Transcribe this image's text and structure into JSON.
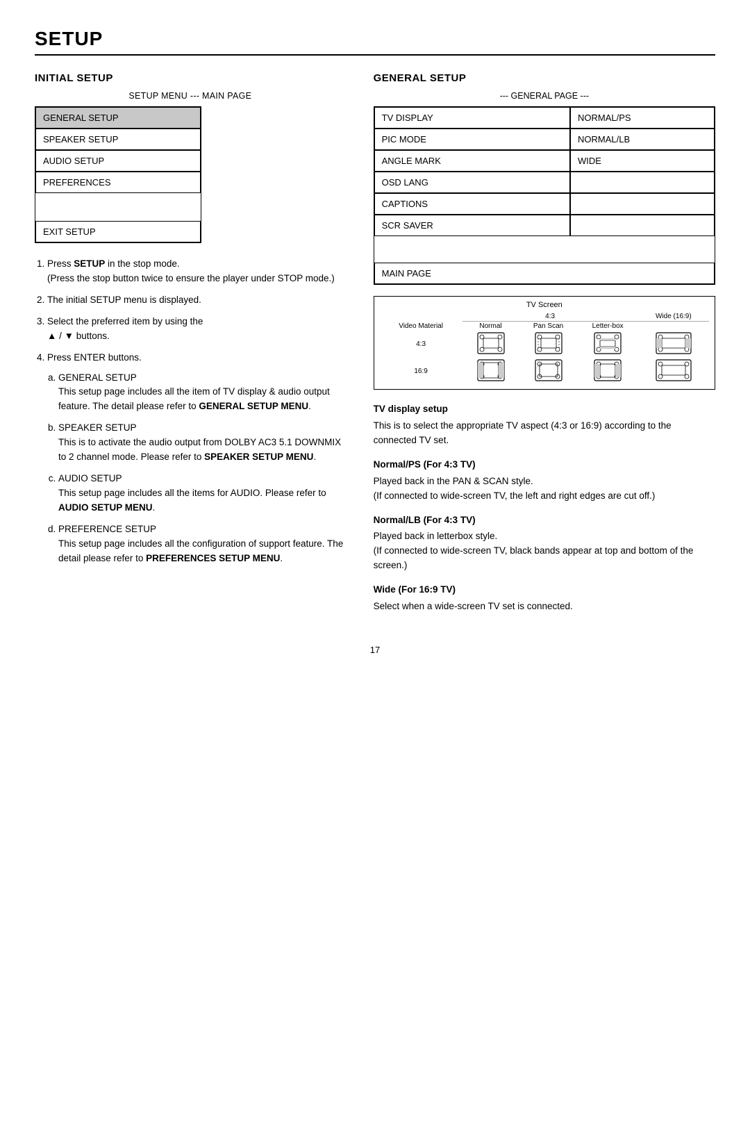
{
  "title": "SETUP",
  "left": {
    "section_title": "INITIAL SETUP",
    "menu_label": "SETUP MENU --- MAIN PAGE",
    "menu_items": [
      {
        "label": "GENERAL SETUP",
        "highlighted": true
      },
      {
        "label": "SPEAKER SETUP",
        "highlighted": false
      },
      {
        "label": "AUDIO SETUP",
        "highlighted": false
      },
      {
        "label": "PREFERENCES",
        "highlighted": false
      }
    ],
    "exit_item": "EXIT SETUP",
    "instructions": [
      {
        "num": "1",
        "text_before": "Press ",
        "bold": "SETUP",
        "text_after": " in the stop mode.\n(Press the stop button twice to ensure the player under STOP mode.)"
      },
      {
        "num": "2",
        "text": "The initial SETUP menu is displayed."
      },
      {
        "num": "3",
        "text_before": "Select the preferred item by using the\n▲ / ▼ buttons."
      },
      {
        "num": "4",
        "text": "Press ENTER buttons.",
        "sub_items": [
          {
            "letter": "a",
            "heading": "GENERAL SETUP",
            "text_before": "This setup page includes all the item of TV display & audio output feature.  The detail please refer to ",
            "bold": "GENERAL SETUP MENU",
            "text_after": "."
          },
          {
            "letter": "b",
            "heading": "SPEAKER SETUP",
            "text_before": "This is to activate the audio output from DOLBY AC3 5.1 DOWNMIX to 2 channel mode.  Please refer to ",
            "bold": "SPEAKER SETUP MENU",
            "text_after": "."
          },
          {
            "letter": "c",
            "heading": "AUDIO SETUP",
            "text_before": "This setup page includes all the items for AUDIO.  Please refer to ",
            "bold": "AUDIO SETUP MENU",
            "text_after": "."
          },
          {
            "letter": "d",
            "heading": "PREFERENCE SETUP",
            "text_before": "This setup page includes all the configuration of support feature.  The detail please refer to ",
            "bold": "PREFERENCES SETUP MENU",
            "text_after": "."
          }
        ]
      }
    ]
  },
  "right": {
    "section_title": "GENERAL SETUP",
    "menu_label": "--- GENERAL PAGE ---",
    "menu_rows": [
      {
        "left": "TV DISPLAY",
        "right": "NORMAL/PS"
      },
      {
        "left": "PIC MODE",
        "right": "NORMAL/LB"
      },
      {
        "left": "ANGLE MARK",
        "right": "WIDE"
      },
      {
        "left": "OSD LANG",
        "right": ""
      },
      {
        "left": "CAPTIONS",
        "right": ""
      },
      {
        "left": "SCR SAVER",
        "right": ""
      }
    ],
    "main_page": "MAIN PAGE",
    "tv_diagram": {
      "title": "TV Screen",
      "col_headers": [
        "",
        "4:3",
        "",
        "Wide (16:9)"
      ],
      "sub_headers": [
        "Video Material",
        "Normal",
        "Pan Scan",
        "Letter-box",
        ""
      ],
      "rows": [
        {
          "label": "4:3",
          "screens": [
            "4:3_normal",
            "4:3_panscan",
            "4:3_letterbox",
            "4:3_wide"
          ]
        },
        {
          "label": "16:9",
          "screens": [
            "16:9_normal",
            "16:9_panscan",
            "16:9_letterbox",
            "16:9_wide"
          ]
        }
      ]
    },
    "descriptions": [
      {
        "title": "TV display setup",
        "text": "This is to select the appropriate TV aspect (4:3 or 16:9) according to the connected TV set."
      },
      {
        "title": "Normal/PS (For 4:3 TV)",
        "text": "Played back in the PAN & SCAN style.\n(If connected to wide-screen TV, the left and right edges are cut off.)"
      },
      {
        "title": "Normal/LB (For 4:3 TV)",
        "text": "Played back in letterbox style.\n(If connected to wide-screen TV, black bands appear at top and bottom of the screen.)"
      },
      {
        "title": "Wide (For 16:9 TV)",
        "text": "Select when a wide-screen TV set is connected."
      }
    ]
  },
  "page_number": "17"
}
